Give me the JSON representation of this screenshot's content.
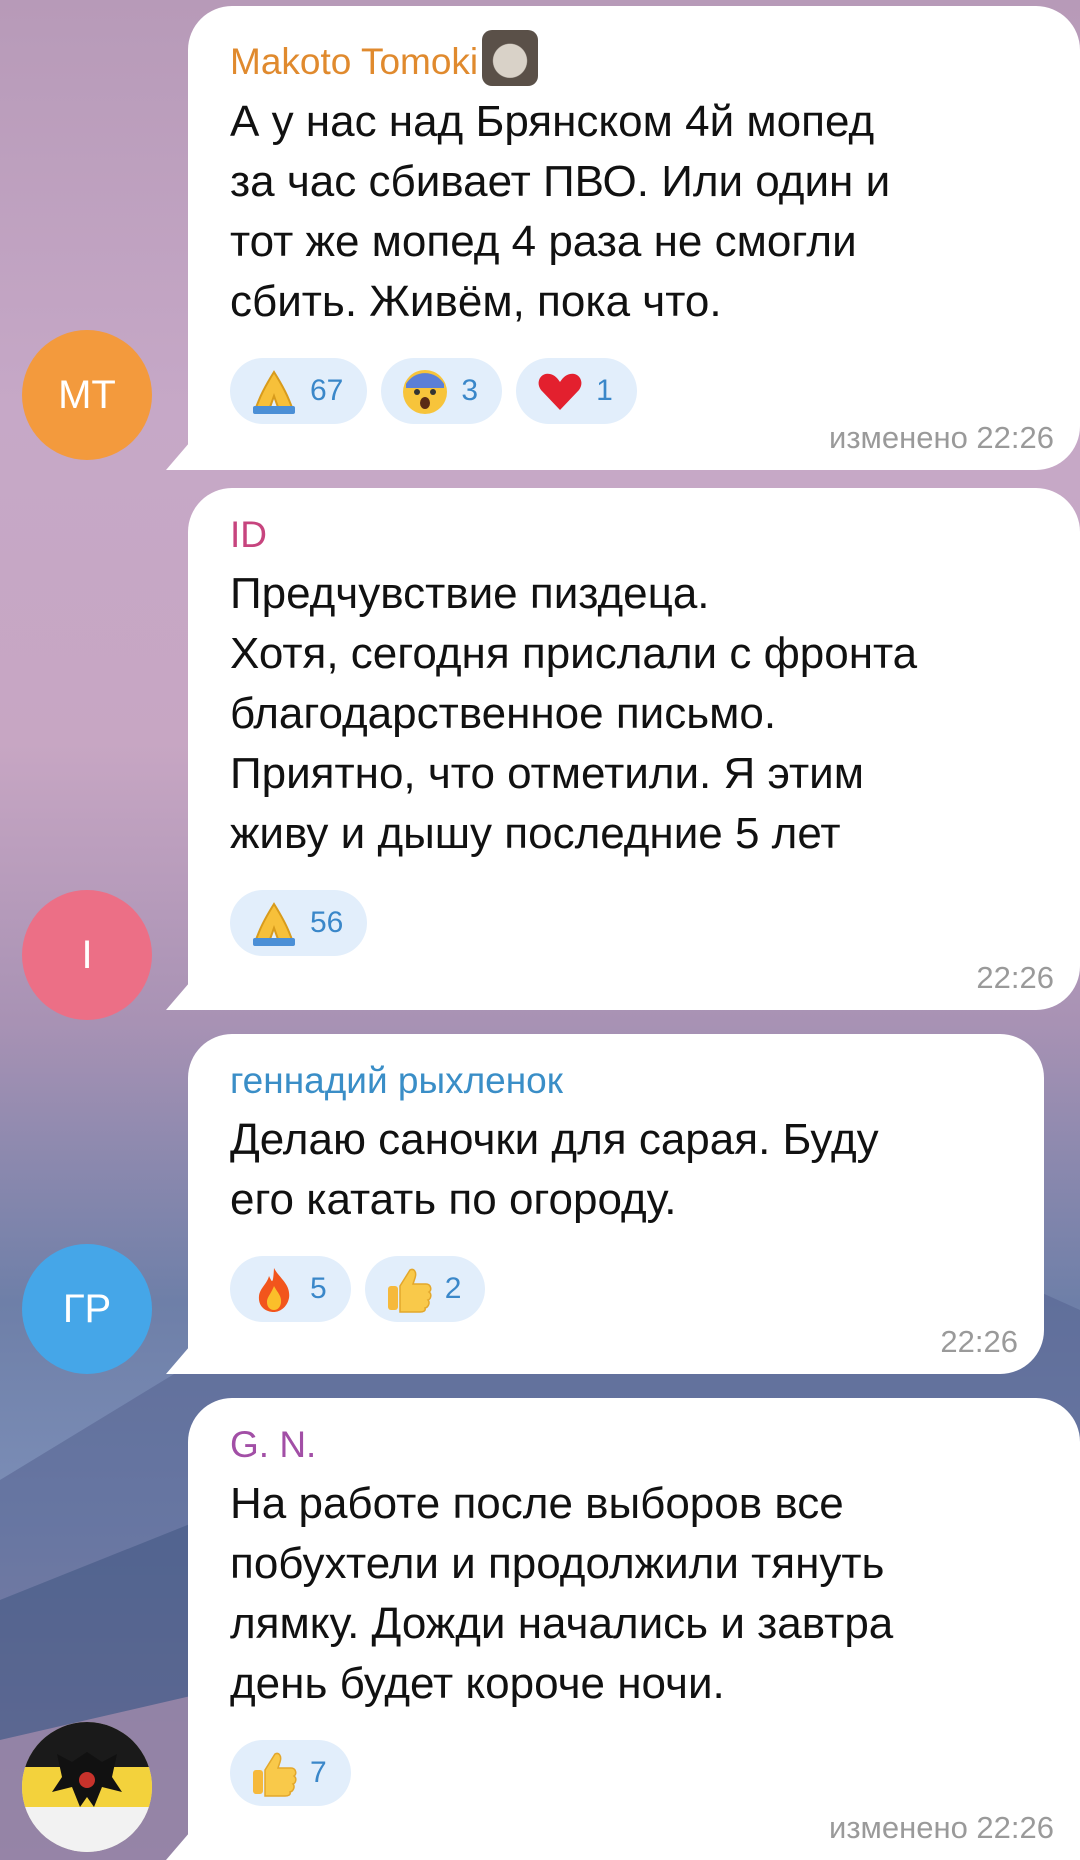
{
  "messages": [
    {
      "avatar_initials": "MT",
      "avatar_color": "#f39a3d",
      "sender": "Makoto Tomoki",
      "sender_color": "#e08a2e",
      "text": "А у нас над Брянском 4й мопед\nза час сбивает ПВО. Или один и\nтот же мопед 4 раза не смогли\nсбить. Живём, пока что.",
      "reactions": [
        {
          "icon": "pray-icon",
          "count": "67"
        },
        {
          "icon": "fearful-face-icon",
          "count": "3"
        },
        {
          "icon": "heart-icon",
          "count": "1"
        }
      ],
      "time": "изменено 22:26"
    },
    {
      "avatar_initials": "I",
      "avatar_color": "#ec6f86",
      "sender": "ID",
      "sender_color": "#c7447e",
      "text": "Предчувствие пиздеца.\nХотя, сегодня прислали с фронта\nблагодарственное письмо.\nПриятно, что отметили.  Я этим\nживу и дышу последние 5 лет",
      "reactions": [
        {
          "icon": "pray-icon",
          "count": "56"
        }
      ],
      "time": "22:26"
    },
    {
      "avatar_initials": "ГР",
      "avatar_color": "#45a6e8",
      "sender": "геннадий рыхленок",
      "sender_color": "#3a8ec7",
      "text": "Делаю саночки для сарая. Буду\nего катать по огороду.",
      "reactions": [
        {
          "icon": "fire-icon",
          "count": "5"
        },
        {
          "icon": "thumbs-up-icon",
          "count": "2"
        }
      ],
      "time": "22:26"
    },
    {
      "avatar_initials": "",
      "avatar_color": "#e9e2c9",
      "sender": "G. N.",
      "sender_color": "#a24fa6",
      "text": "На работе после выборов все\nпобухтели  и продолжили тянуть\nлямку. Дожди начались и завтра\nдень будет короче ночи.",
      "reactions": [
        {
          "icon": "thumbs-up-icon",
          "count": "7"
        }
      ],
      "time": "изменено 22:26"
    }
  ]
}
